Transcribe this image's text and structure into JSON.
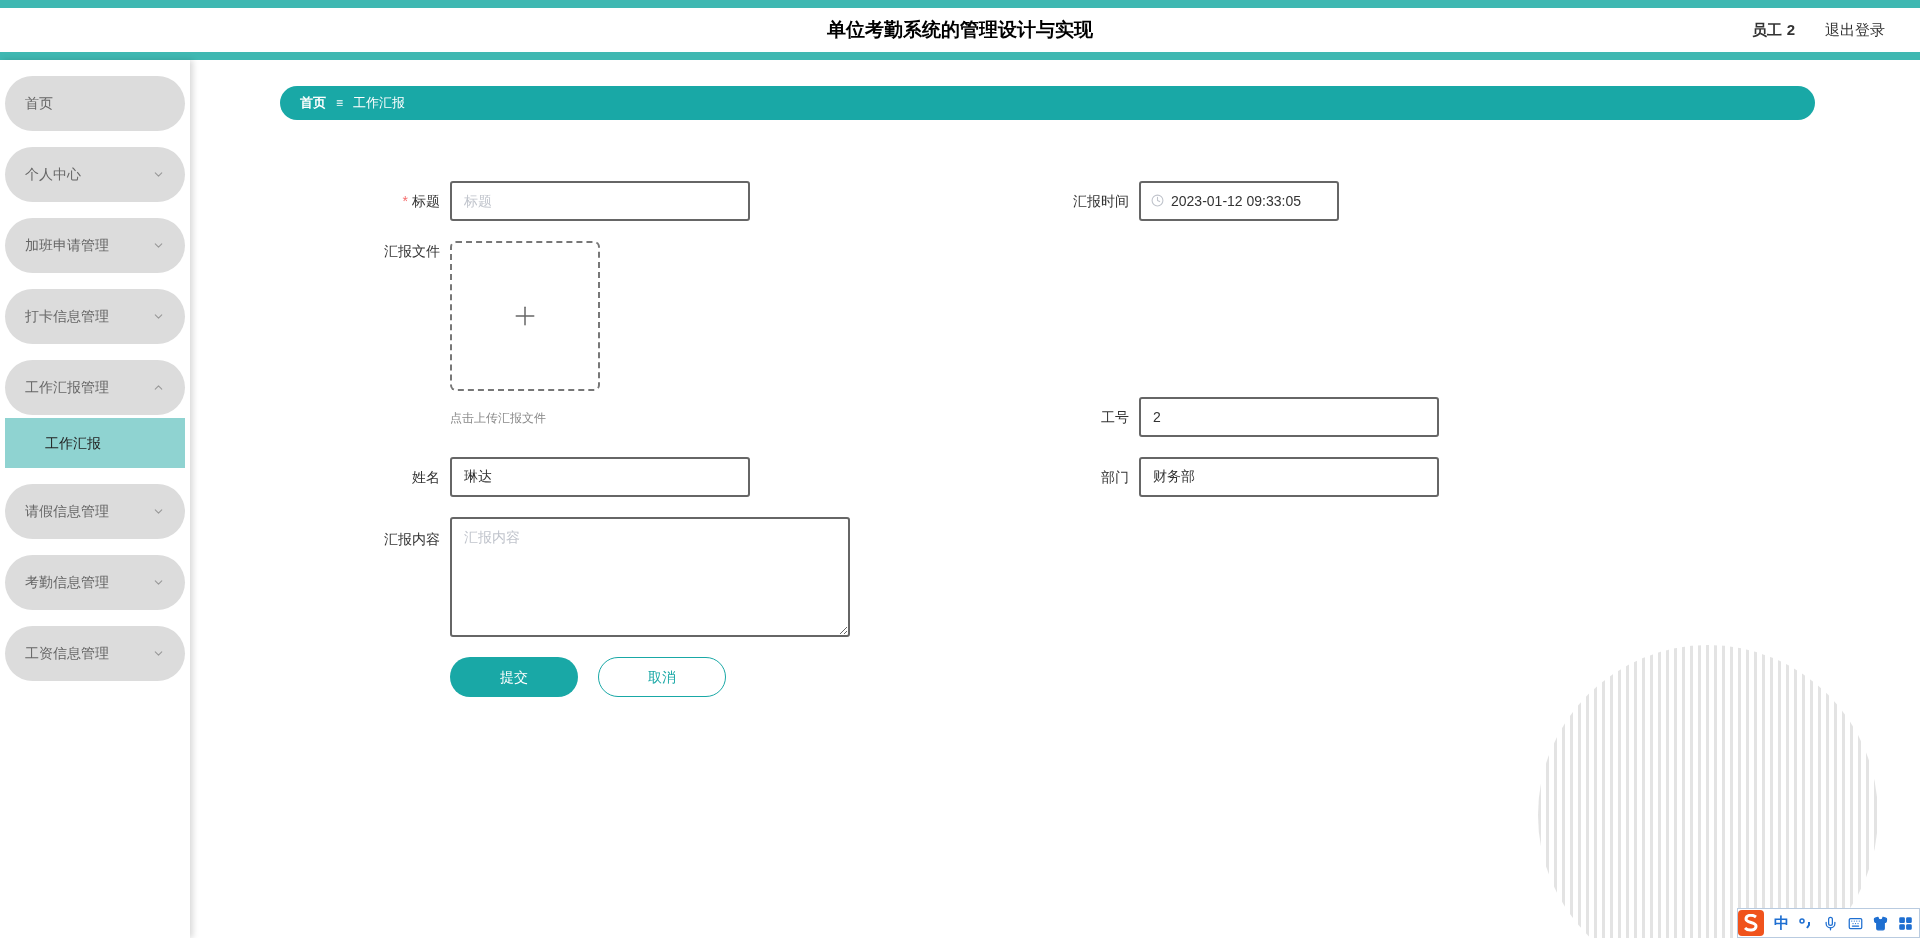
{
  "header": {
    "title": "单位考勤系统的管理设计与实现",
    "user": "员工 2",
    "logout": "退出登录"
  },
  "sidebar": {
    "items": [
      {
        "kind": "link",
        "label": "首页"
      },
      {
        "kind": "menu",
        "label": "个人中心",
        "expanded": false
      },
      {
        "kind": "menu",
        "label": "加班申请管理",
        "expanded": false
      },
      {
        "kind": "menu",
        "label": "打卡信息管理",
        "expanded": false
      },
      {
        "kind": "menu",
        "label": "工作汇报管理",
        "expanded": true,
        "children": [
          {
            "label": "工作汇报",
            "selected": true
          }
        ]
      },
      {
        "kind": "menu",
        "label": "请假信息管理",
        "expanded": false
      },
      {
        "kind": "menu",
        "label": "考勤信息管理",
        "expanded": false
      },
      {
        "kind": "menu",
        "label": "工资信息管理",
        "expanded": false
      }
    ]
  },
  "breadcrumb": {
    "separator": "≡",
    "items": [
      "首页",
      "工作汇报"
    ]
  },
  "form": {
    "title": {
      "label": "标题",
      "required": true,
      "required_mark": "*",
      "placeholder": "标题"
    },
    "report_time": {
      "label": "汇报时间",
      "value": "2023-01-12 09:33:05"
    },
    "file": {
      "label": "汇报文件",
      "hint": "点击上传汇报文件"
    },
    "employee_no": {
      "label": "工号",
      "value": "2"
    },
    "name": {
      "label": "姓名",
      "value": "琳达"
    },
    "department": {
      "label": "部门",
      "value": "财务部"
    },
    "content": {
      "label": "汇报内容",
      "placeholder": "汇报内容"
    },
    "submit": "提交",
    "cancel": "取消"
  },
  "ime_toolbar": {
    "mode": "中"
  }
}
